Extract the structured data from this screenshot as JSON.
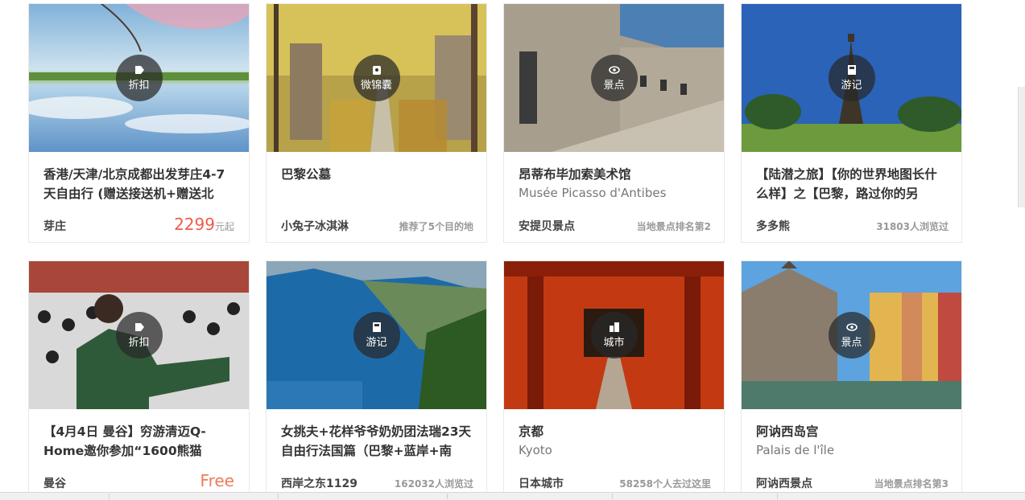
{
  "cards": [
    {
      "badge": "折扣",
      "title": "香港/天津/北京成都出发芽庄4-7天自由行 (赠送接送机+赠送北",
      "subtitle": "",
      "left": "芽庄",
      "right": "",
      "price": "2299",
      "price_unit": "元起",
      "free": ""
    },
    {
      "badge": "微锦囊",
      "title": "巴黎公墓",
      "subtitle": "",
      "left": "小兔子冰淇淋",
      "right": "推荐了5个目的地",
      "price": "",
      "price_unit": "",
      "free": ""
    },
    {
      "badge": "景点",
      "title": "昂蒂布毕加索美术馆",
      "subtitle": "Musée Picasso d'Antibes",
      "left": "安提贝景点",
      "right": "当地景点排名第2",
      "price": "",
      "price_unit": "",
      "free": ""
    },
    {
      "badge": "游记",
      "title": "【陆潜之旅】【你的世界地图长什么样】之【巴黎，路过你的另",
      "subtitle": "",
      "left": "多多熊",
      "right": "31803人浏览过",
      "price": "",
      "price_unit": "",
      "free": ""
    },
    {
      "badge": "折扣",
      "title": "【4月4日 曼谷】穷游清迈Q-Home邀你参加“1600熊猫",
      "subtitle": "",
      "left": "曼谷",
      "right": "",
      "price": "",
      "price_unit": "",
      "free": "Free"
    },
    {
      "badge": "游记",
      "title": "女挑夫+花样爷爷奶奶团法瑞23天自由行法国篇（巴黎+蓝岸+南",
      "subtitle": "",
      "left": "西岸之东1129",
      "right": "162032人浏览过",
      "price": "",
      "price_unit": "",
      "free": ""
    },
    {
      "badge": "城市",
      "title": "京都",
      "subtitle": "Kyoto",
      "left": "日本城市",
      "right": "58258个人去过这里",
      "price": "",
      "price_unit": "",
      "free": ""
    },
    {
      "badge": "景点",
      "title": "阿讷西岛宫",
      "subtitle": "Palais de l'île",
      "left": "阿讷西景点",
      "right": "当地景点排名第3",
      "price": "",
      "price_unit": "",
      "free": ""
    }
  ],
  "images": [
    "lake-reflection-photo",
    "tree-lined-cemetery-path-photo",
    "stone-museum-building-photo",
    "eiffel-tower-photo",
    "panda-sculptures-crowd-photo",
    "coastal-bay-photo",
    "torii-gate-tunnel-photo",
    "canal-castle-town-photo"
  ],
  "icons": {
    "折扣": "tag-icon",
    "微锦囊": "pouch-icon",
    "景点": "eye-icon",
    "游记": "book-icon",
    "城市": "city-icon"
  }
}
